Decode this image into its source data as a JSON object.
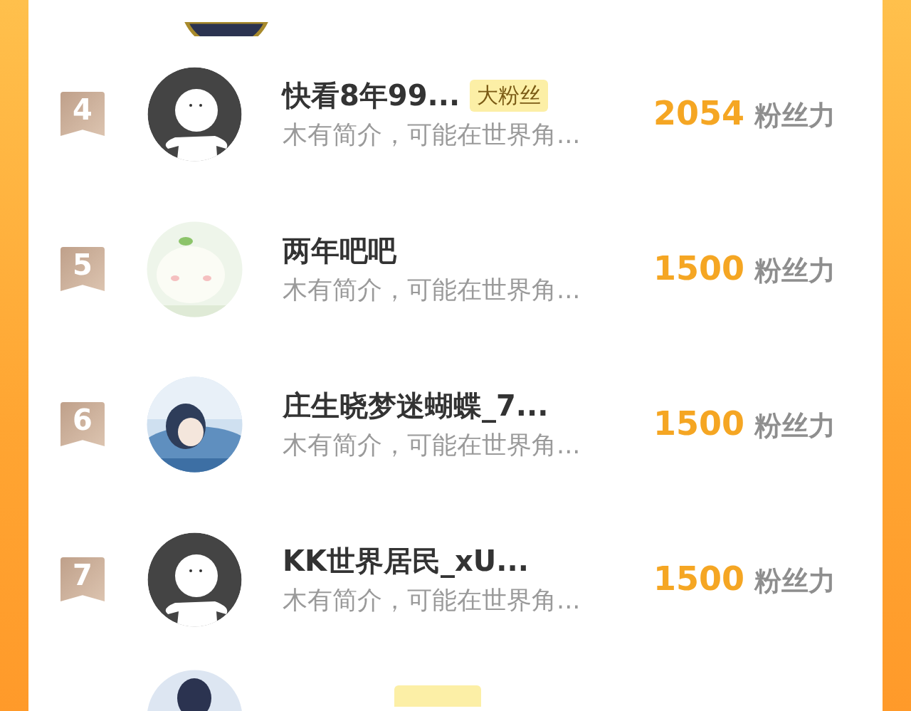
{
  "fans": [
    {
      "rank": "4",
      "avatar": {
        "kind": "default"
      },
      "name": "快看8年99...",
      "badge": "大粉丝",
      "intro": "木有简介，可能在世界角...",
      "score": "2054",
      "score_unit": "粉丝力"
    },
    {
      "rank": "5",
      "name": "两年吧吧",
      "intro": "木有简介，可能在世界角...",
      "score": "1500",
      "score_unit": "粉丝力"
    },
    {
      "rank": "6",
      "name": "庄生晓梦迷蝴蝶_7...",
      "intro": "木有简介，可能在世界角...",
      "score": "1500",
      "score_unit": "粉丝力"
    },
    {
      "rank": "7",
      "avatar": {
        "kind": "default"
      },
      "name": "KK世界居民_xU...",
      "intro": "木有简介，可能在世界角...",
      "score": "1500",
      "score_unit": "粉丝力"
    }
  ],
  "partial_row": {
    "badge": true
  }
}
